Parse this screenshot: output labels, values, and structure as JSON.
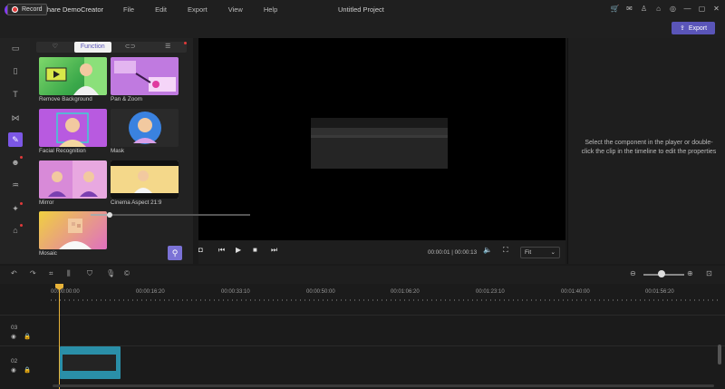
{
  "titlebar": {
    "app_name": "Wondershare DemoCreator",
    "menu": [
      "File",
      "Edit",
      "Export",
      "View",
      "Help"
    ],
    "project_title": "Untitled Project"
  },
  "toolbar": {
    "record_label": "Record",
    "export_label": "Export"
  },
  "library": {
    "tabs": [
      "♡",
      "Function",
      "⊂⊃",
      "☰"
    ],
    "active_tab": "Function",
    "items": [
      {
        "label": "Remove Background"
      },
      {
        "label": "Pan & Zoom"
      },
      {
        "label": "Facial Recognition"
      },
      {
        "label": "Mask"
      },
      {
        "label": "Mirror"
      },
      {
        "label": "Cinema Aspect 21:9"
      },
      {
        "label": "Mosaic"
      }
    ]
  },
  "player": {
    "timecode": "00:00:01 | 00:00:13",
    "progress": 0.12,
    "fit_option": "Fit"
  },
  "properties": {
    "hint": "Select the component in the player or double-click the clip in the timeline to edit the properties"
  },
  "timeline": {
    "ruler": [
      "00:00:00:00",
      "00:00:16:20",
      "00:00:33:10",
      "00:00:50:00",
      "00:01:06:20",
      "00:01:23:10",
      "00:01:40:00",
      "00:01:56:20"
    ],
    "tracks": [
      {
        "number": "03"
      },
      {
        "number": "02"
      }
    ],
    "zoom_level": 0.45
  },
  "colors": {
    "accent": "#7c57e6",
    "export": "#5a55b8",
    "playhead": "#e8b339",
    "clip": "#2a8fa8"
  }
}
